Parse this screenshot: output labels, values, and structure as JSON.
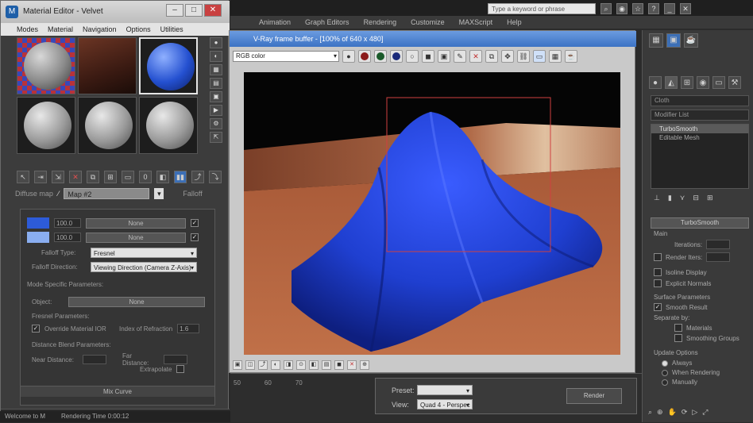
{
  "app": {
    "menu": [
      "Animation",
      "Graph Editors",
      "Rendering",
      "Customize",
      "MAXScript",
      "Help"
    ],
    "search_placeholder": "Type a keyword or phrase"
  },
  "material_editor": {
    "title": "Material Editor - Velvet",
    "menu": [
      "Modes",
      "Material",
      "Navigation",
      "Options",
      "Utilities"
    ],
    "map_label": "Diffuse map",
    "map_name": "Map #2",
    "map_type": "Falloff",
    "front_side": {
      "value": "100.0",
      "button": "None"
    },
    "side_side": {
      "value": "100.0",
      "button": "None"
    },
    "falloff_type_label": "Falloff Type:",
    "falloff_type_value": "Fresnel",
    "falloff_direction_label": "Falloff Direction:",
    "falloff_direction_value": "Viewing Direction (Camera Z-Axis)",
    "mode_specific_label": "Mode Specific Parameters:",
    "object_label": "Object:",
    "object_value": "None",
    "fresnel_label": "Fresnel Parameters:",
    "override_label": "Override Material IOR",
    "ior_label": "Index of Refraction",
    "ior_value": "1.6",
    "distance_label": "Distance Blend Parameters:",
    "near_label": "Near Distance:",
    "far_label": "Far Distance:",
    "extrapolate_label": "Extrapolate",
    "mix_curve": "Mix Curve",
    "status_left": "Welcome to M"
  },
  "frame_buffer": {
    "title": "V-Ray frame buffer - [100% of 640 x 480]",
    "channel": "RGB color",
    "colors": {
      "red": "#8b1a1a",
      "green": "#1a5a2a",
      "blue": "#1a2a7a",
      "cloth": "#1f3fd0",
      "floor": "#9a5a3a"
    }
  },
  "command_panel": {
    "object_name": "Cloth",
    "modifier_list": "Modifier List",
    "stack": [
      "TurboSmooth",
      "Editable Mesh"
    ],
    "rollout_title": "TurboSmooth",
    "main_label": "Main",
    "iterations_label": "Iterations:",
    "render_iters_label": "Render Iters:",
    "isoline_label": "Isoline Display",
    "explicit_label": "Explicit Normals",
    "surface_label": "Surface Parameters",
    "smooth_result_label": "Smooth Result",
    "separate_label": "Separate by:",
    "materials_label": "Materials",
    "smoothing_label": "Smoothing Groups",
    "update_label": "Update Options",
    "always_label": "Always",
    "when_rendering_label": "When Rendering",
    "manually_label": "Manually"
  },
  "bottom": {
    "timeline": [
      "50",
      "60",
      "70"
    ],
    "preset_label": "Preset:",
    "view_label": "View:",
    "view_value": "Quad 4 - Perspec",
    "render_label": "Render",
    "rendering_time": "Rendering Time 0:00:12"
  }
}
